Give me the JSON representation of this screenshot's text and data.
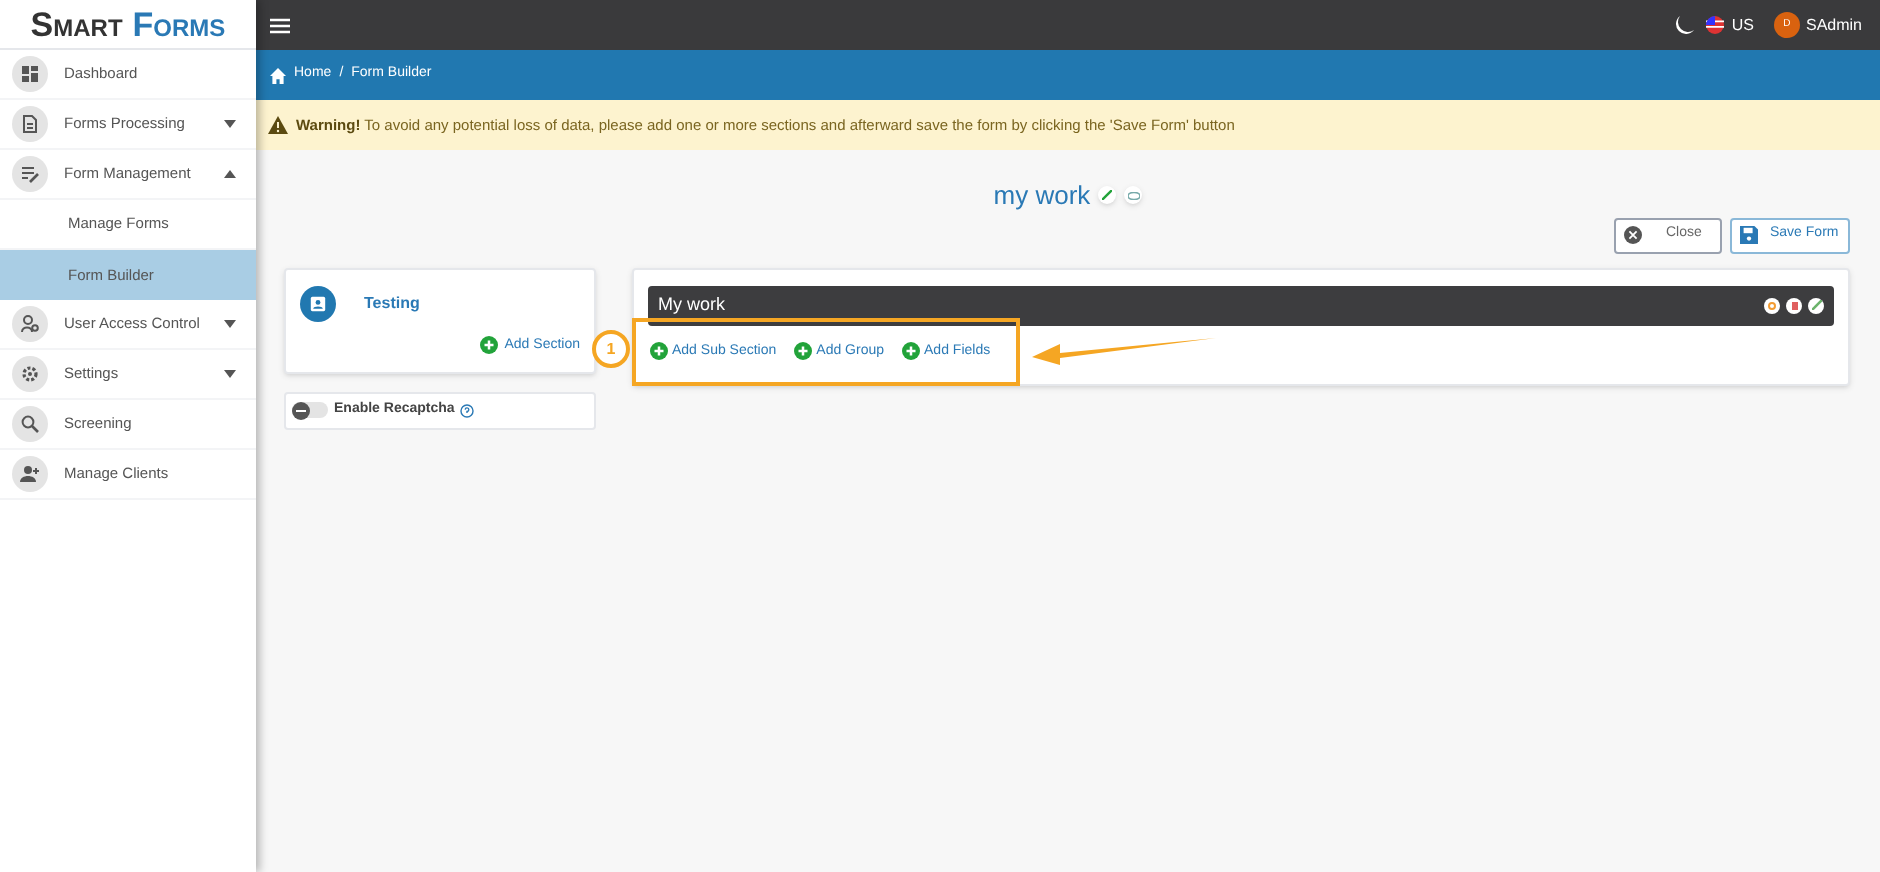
{
  "logo": {
    "first": "Smart",
    "second": "Forms"
  },
  "sidebar": {
    "items": [
      {
        "label": "Dashboard",
        "kind": "plain"
      },
      {
        "label": "Forms Processing",
        "kind": "group",
        "expanded": false
      },
      {
        "label": "Form Management",
        "kind": "group",
        "expanded": true,
        "children": [
          {
            "label": "Manage Forms",
            "selected": false
          },
          {
            "label": "Form Builder",
            "selected": true
          }
        ]
      },
      {
        "label": "User Access Control",
        "kind": "group",
        "expanded": false
      },
      {
        "label": "Settings",
        "kind": "group",
        "expanded": false
      },
      {
        "label": "Screening",
        "kind": "plain"
      },
      {
        "label": "Manage Clients",
        "kind": "plain"
      }
    ]
  },
  "topbar": {
    "language": "US",
    "avatar_initial": "D",
    "user": "SAdmin"
  },
  "breadcrumb": {
    "items": [
      "Home",
      "Form Builder"
    ],
    "separator": "/"
  },
  "warning": {
    "lead": "Warning!",
    "text": "To avoid any potential loss of data, please add one or more sections and afterward save the form by clicking the 'Save Form' button"
  },
  "form": {
    "title": "my work",
    "buttons": [
      "Close",
      "Save Form"
    ]
  },
  "sections_panel": {
    "section": "Testing",
    "add_section": "Add Section",
    "recaptcha": {
      "label": "Enable Recaptcha",
      "on": false
    }
  },
  "section_editor": {
    "title": "My work",
    "actions": [
      "Add Sub Section",
      "Add Group",
      "Add Fields"
    ]
  },
  "annotation": {
    "number": "1"
  }
}
